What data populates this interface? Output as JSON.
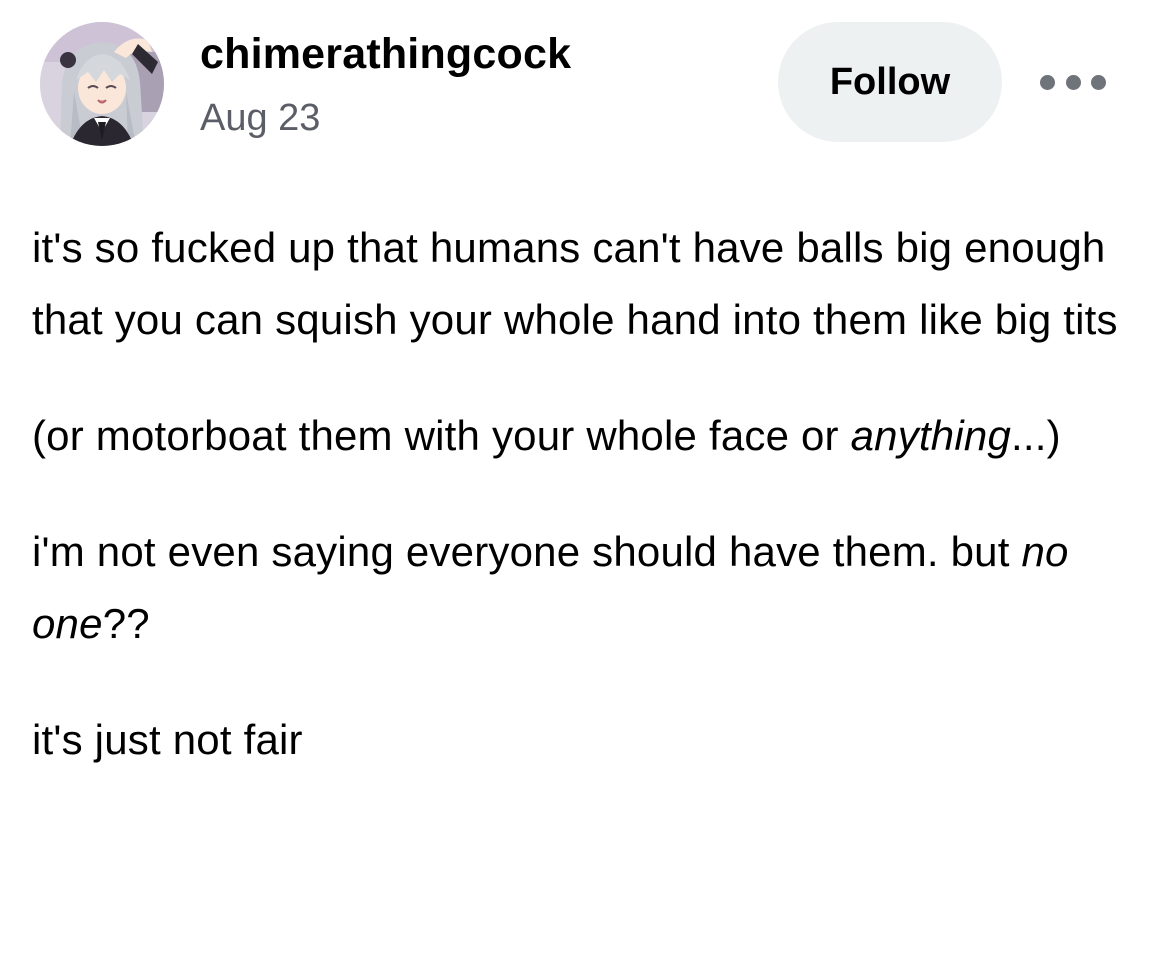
{
  "post": {
    "author": {
      "username": "chimerathingcock",
      "avatar": "anime-character-avatar"
    },
    "date": "Aug 23",
    "follow_label": "Follow",
    "more_icon": "more-options-icon",
    "paragraphs": [
      {
        "text": "it's so fucked up that humans can't have balls big enough that you can squish your whole hand into them like big tits"
      },
      {
        "prefix": "(or motorboat them with your whole face or ",
        "emphasis": "anything",
        "suffix": "...)"
      },
      {
        "prefix": "i'm not even saying everyone should have them. but ",
        "emphasis": "no one",
        "suffix": "??"
      },
      {
        "text": "it's just not fair"
      }
    ]
  },
  "colors": {
    "background": "#ffffff",
    "text": "#000000",
    "date_text": "#5b5e66",
    "follow_button_bg": "#eef1f1",
    "more_dots": "#6f737a"
  }
}
